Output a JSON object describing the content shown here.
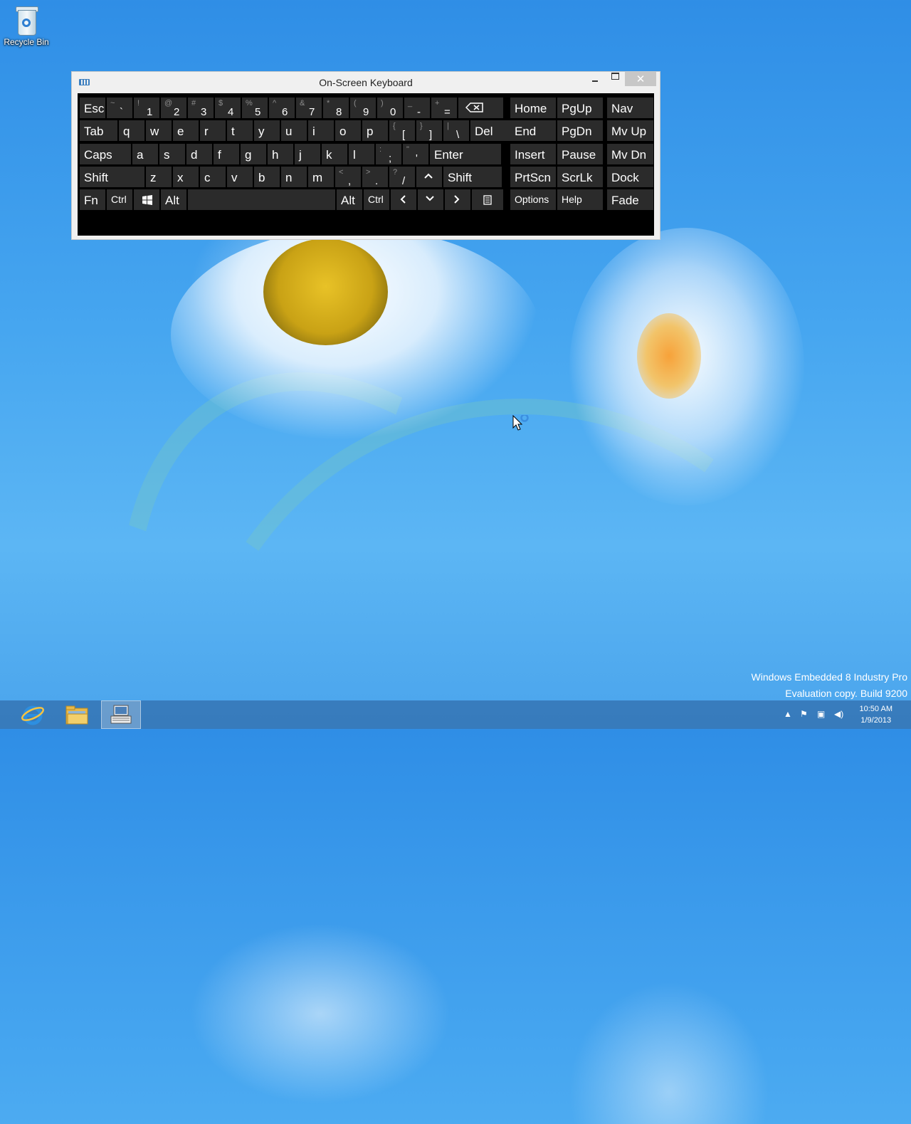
{
  "desktop": {
    "icons": [
      {
        "label": "Recycle Bin",
        "icon": "recycle-bin-icon"
      }
    ]
  },
  "osk": {
    "title": "On-Screen Keyboard",
    "rows": [
      [
        {
          "id": "esc",
          "label": "Esc"
        },
        {
          "id": "backtick",
          "up": "~",
          "dn": "`"
        },
        {
          "id": "1",
          "up": "!",
          "dn": "1"
        },
        {
          "id": "2",
          "up": "@",
          "dn": "2"
        },
        {
          "id": "3",
          "up": "#",
          "dn": "3"
        },
        {
          "id": "4",
          "up": "$",
          "dn": "4"
        },
        {
          "id": "5",
          "up": "%",
          "dn": "5"
        },
        {
          "id": "6",
          "up": "^",
          "dn": "6"
        },
        {
          "id": "7",
          "up": "&",
          "dn": "7"
        },
        {
          "id": "8",
          "up": "*",
          "dn": "8"
        },
        {
          "id": "9",
          "up": "(",
          "dn": "9"
        },
        {
          "id": "0",
          "up": ")",
          "dn": "0"
        },
        {
          "id": "minus",
          "up": "_",
          "dn": "-"
        },
        {
          "id": "equals",
          "up": "+",
          "dn": "="
        },
        {
          "id": "backspace",
          "icon": "backspace-icon"
        }
      ],
      [
        {
          "id": "tab",
          "label": "Tab"
        },
        {
          "id": "q",
          "label": "q"
        },
        {
          "id": "w",
          "label": "w"
        },
        {
          "id": "e",
          "label": "e"
        },
        {
          "id": "r",
          "label": "r"
        },
        {
          "id": "t",
          "label": "t"
        },
        {
          "id": "y",
          "label": "y"
        },
        {
          "id": "u",
          "label": "u"
        },
        {
          "id": "i",
          "label": "i"
        },
        {
          "id": "o",
          "label": "o"
        },
        {
          "id": "p",
          "label": "p"
        },
        {
          "id": "lbracket",
          "up": "{",
          "dn": "["
        },
        {
          "id": "rbracket",
          "up": "}",
          "dn": "]"
        },
        {
          "id": "backslash",
          "up": "|",
          "dn": "\\"
        },
        {
          "id": "del",
          "label": "Del"
        }
      ],
      [
        {
          "id": "caps",
          "label": "Caps"
        },
        {
          "id": "a",
          "label": "a"
        },
        {
          "id": "s",
          "label": "s"
        },
        {
          "id": "d",
          "label": "d"
        },
        {
          "id": "f",
          "label": "f"
        },
        {
          "id": "g",
          "label": "g"
        },
        {
          "id": "h",
          "label": "h"
        },
        {
          "id": "j",
          "label": "j"
        },
        {
          "id": "k",
          "label": "k"
        },
        {
          "id": "l",
          "label": "l"
        },
        {
          "id": "semicolon",
          "up": ":",
          "dn": ";"
        },
        {
          "id": "quote",
          "up": "\"",
          "dn": "'"
        },
        {
          "id": "enter",
          "label": "Enter"
        }
      ],
      [
        {
          "id": "lshift",
          "label": "Shift"
        },
        {
          "id": "z",
          "label": "z"
        },
        {
          "id": "x",
          "label": "x"
        },
        {
          "id": "c",
          "label": "c"
        },
        {
          "id": "v",
          "label": "v"
        },
        {
          "id": "b",
          "label": "b"
        },
        {
          "id": "n",
          "label": "n"
        },
        {
          "id": "m",
          "label": "m"
        },
        {
          "id": "comma",
          "up": "<",
          "dn": ","
        },
        {
          "id": "period",
          "up": ">",
          "dn": "."
        },
        {
          "id": "slash",
          "up": "?",
          "dn": "/"
        },
        {
          "id": "uparrow",
          "icon": "up-arrow-icon"
        },
        {
          "id": "rshift",
          "label": "Shift"
        }
      ],
      [
        {
          "id": "fn",
          "label": "Fn"
        },
        {
          "id": "lctrl",
          "label": "Ctrl",
          "small": true
        },
        {
          "id": "win",
          "icon": "windows-logo-icon"
        },
        {
          "id": "lalt",
          "label": "Alt"
        },
        {
          "id": "space",
          "label": ""
        },
        {
          "id": "ralt",
          "label": "Alt"
        },
        {
          "id": "rctrl",
          "label": "Ctrl",
          "small": true
        },
        {
          "id": "leftarrow",
          "icon": "left-arrow-icon"
        },
        {
          "id": "downarrow",
          "icon": "down-arrow-icon"
        },
        {
          "id": "rightarrow",
          "icon": "right-arrow-icon"
        },
        {
          "id": "menu",
          "icon": "context-menu-icon"
        }
      ]
    ],
    "nav_cols": [
      [
        {
          "id": "home",
          "label": "Home"
        },
        {
          "id": "end",
          "label": "End"
        },
        {
          "id": "insert",
          "label": "Insert"
        },
        {
          "id": "prtscn",
          "label": "PrtScn"
        },
        {
          "id": "options",
          "label": "Options",
          "small": true
        }
      ],
      [
        {
          "id": "pgup",
          "label": "PgUp"
        },
        {
          "id": "pgdn",
          "label": "PgDn"
        },
        {
          "id": "pause",
          "label": "Pause"
        },
        {
          "id": "scrlk",
          "label": "ScrLk"
        },
        {
          "id": "help",
          "label": "Help",
          "small": true
        }
      ],
      [
        {
          "id": "nav",
          "label": "Nav"
        },
        {
          "id": "mvup",
          "label": "Mv Up"
        },
        {
          "id": "mvdn",
          "label": "Mv Dn"
        },
        {
          "id": "dock",
          "label": "Dock"
        },
        {
          "id": "fade",
          "label": "Fade"
        }
      ]
    ]
  },
  "watermark": {
    "line1": "Windows Embedded 8 Industry Pro",
    "line2": "Evaluation copy. Build 9200"
  },
  "taskbar": {
    "apps": [
      {
        "name": "internet-explorer",
        "icon": "internet-explorer-icon"
      },
      {
        "name": "file-explorer",
        "icon": "folder-icon"
      },
      {
        "name": "on-screen-keyboard",
        "icon": "keyboard-icon",
        "active": true
      }
    ],
    "clock": {
      "time": "10:50 AM",
      "date": "1/9/2013"
    }
  }
}
